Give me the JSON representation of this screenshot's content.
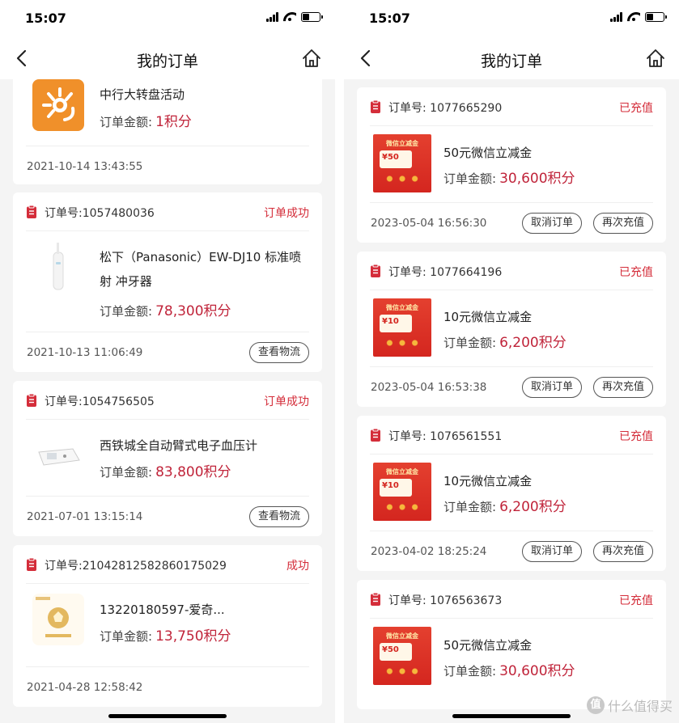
{
  "status_bar": {
    "time": "15:07"
  },
  "nav": {
    "title": "我的订单"
  },
  "left_orders": [
    {
      "name": "中行大转盘活动",
      "amount_label": "订单金额:",
      "amount": "1积分",
      "date": "2021-10-14 13:43:55"
    },
    {
      "order_no": "订单号:1057480036",
      "status": "订单成功",
      "name": "松下（Panasonic）EW-DJ10 标准喷射 冲牙器",
      "amount_label": "订单金额:",
      "amount": "78,300积分",
      "date": "2021-10-13 11:06:49",
      "button": "查看物流"
    },
    {
      "order_no": "订单号:1054756505",
      "status": "订单成功",
      "name": "西铁城全自动臂式电子血压计",
      "amount_label": "订单金额:",
      "amount": "83,800积分",
      "date": "2021-07-01 13:15:14",
      "button": "查看物流"
    },
    {
      "order_no": "订单号:21042812582860175029",
      "status": "成功",
      "name": "13220180597-爱奇...",
      "amount_label": "订单金额:",
      "amount": "13,750积分",
      "date": "2021-04-28 12:58:42"
    }
  ],
  "right_orders": [
    {
      "order_no": "订单号: 1077665290",
      "status": "已充值",
      "name": "50元微信立减金",
      "amount_label": "订单金额:",
      "amount": "30,600积分",
      "date": "2023-05-04 16:56:30",
      "btn_cancel": "取消订单",
      "btn_again": "再次充值",
      "coupon_title": "微信立减金",
      "coupon_value": "¥50"
    },
    {
      "order_no": "订单号: 1077664196",
      "status": "已充值",
      "name": "10元微信立减金",
      "amount_label": "订单金额:",
      "amount": "6,200积分",
      "date": "2023-05-04 16:53:38",
      "btn_cancel": "取消订单",
      "btn_again": "再次充值",
      "coupon_title": "微信立减金",
      "coupon_value": "¥10"
    },
    {
      "order_no": "订单号: 1076561551",
      "status": "已充值",
      "name": "10元微信立减金",
      "amount_label": "订单金额:",
      "amount": "6,200积分",
      "date": "2023-04-02 18:25:24",
      "btn_cancel": "取消订单",
      "btn_again": "再次充值",
      "coupon_title": "微信立减金",
      "coupon_value": "¥10"
    },
    {
      "order_no": "订单号: 1076563673",
      "status": "已充值",
      "name": "50元微信立减金",
      "amount_label": "订单金额:",
      "amount": "30,600积分",
      "coupon_title": "微信立减金",
      "coupon_value": "¥50"
    }
  ],
  "watermark": {
    "icon_char": "值",
    "text": "什么值得买"
  },
  "colors": {
    "accent_red": "#d42d3a",
    "amount_red": "#c0243a",
    "background": "#f4f4f4"
  }
}
